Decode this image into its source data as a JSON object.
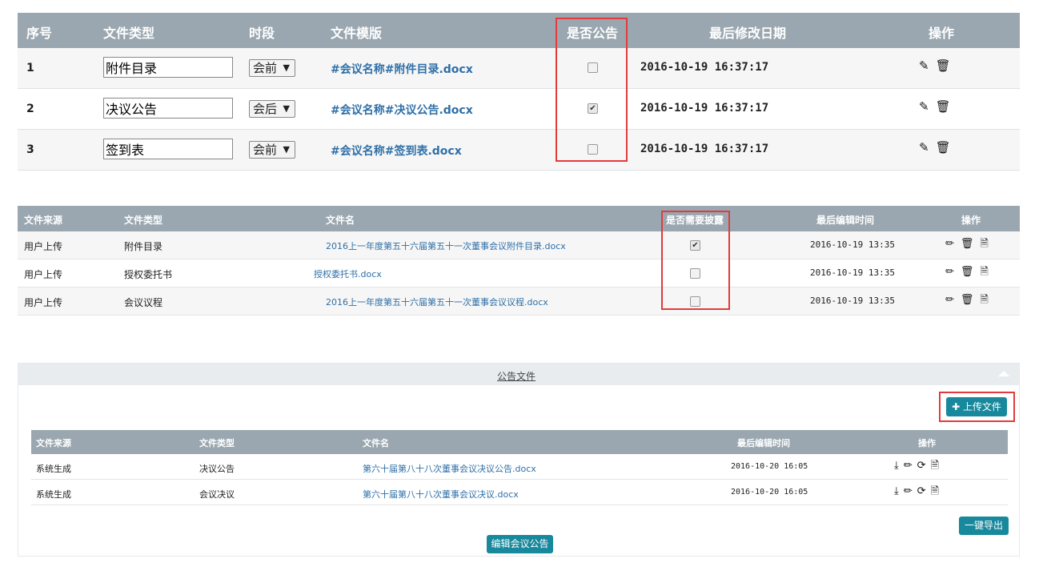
{
  "table1": {
    "headers": [
      "序号",
      "文件类型",
      "时段",
      "文件模版",
      "是否公告",
      "最后修改日期",
      "操作"
    ],
    "rows": [
      {
        "no": "1",
        "type": "附件目录",
        "period": "会前",
        "template": "#会议名称#附件目录.docx",
        "public": false,
        "date": "2016-10-19  16:37:17"
      },
      {
        "no": "2",
        "type": "决议公告",
        "period": "会后",
        "template": "#会议名称#决议公告.docx",
        "public": true,
        "date": "2016-10-19  16:37:17"
      },
      {
        "no": "3",
        "type": "签到表",
        "period": "会前",
        "template": "#会议名称#签到表.docx",
        "public": false,
        "date": "2016-10-19  16:37:17"
      }
    ]
  },
  "table2": {
    "headers": [
      "文件来源",
      "文件类型",
      "文件名",
      "是否需要披露",
      "最后编辑时间",
      "操作"
    ],
    "rows": [
      {
        "source": "用户上传",
        "type": "附件目录",
        "name": "2016上一年度第五十六届第五十一次董事会议附件目录.docx",
        "disclose": true,
        "time": "2016-10-19 13:35"
      },
      {
        "source": "用户上传",
        "type": "授权委托书",
        "name": "授权委托书.docx",
        "disclose": false,
        "time": "2016-10-19 13:35"
      },
      {
        "source": "用户上传",
        "type": "会议议程",
        "name": "2016上一年度第五十六届第五十一次董事会议议程.docx",
        "disclose": false,
        "time": "2016-10-19 13:35"
      }
    ]
  },
  "panel": {
    "title": "公告文件",
    "upload_label": "✚ 上传文件",
    "export_label": "一键导出",
    "edit_label": "编辑会议公告",
    "table": {
      "headers": [
        "文件来源",
        "文件类型",
        "文件名",
        "最后编辑时间",
        "操作"
      ],
      "rows": [
        {
          "source": "系统生成",
          "type": "决议公告",
          "name": "第六十届第八十八次董事会议决议公告.docx",
          "time": "2016-10-20 16:05"
        },
        {
          "source": "系统生成",
          "type": "会议决议",
          "name": "第六十届第八十八次董事会议决议.docx",
          "time": "2016-10-20 16:05"
        }
      ]
    }
  },
  "icons": {
    "edit": "✎",
    "trash": "🗑",
    "pencil": "✏",
    "doc": "🗎",
    "download": "⤓",
    "refresh": "⟳",
    "check": "✔"
  },
  "colors": {
    "header_bg": "#9aa7b0",
    "link": "#2e6fa8",
    "button": "#18889c",
    "highlight": "#e23b3b"
  }
}
